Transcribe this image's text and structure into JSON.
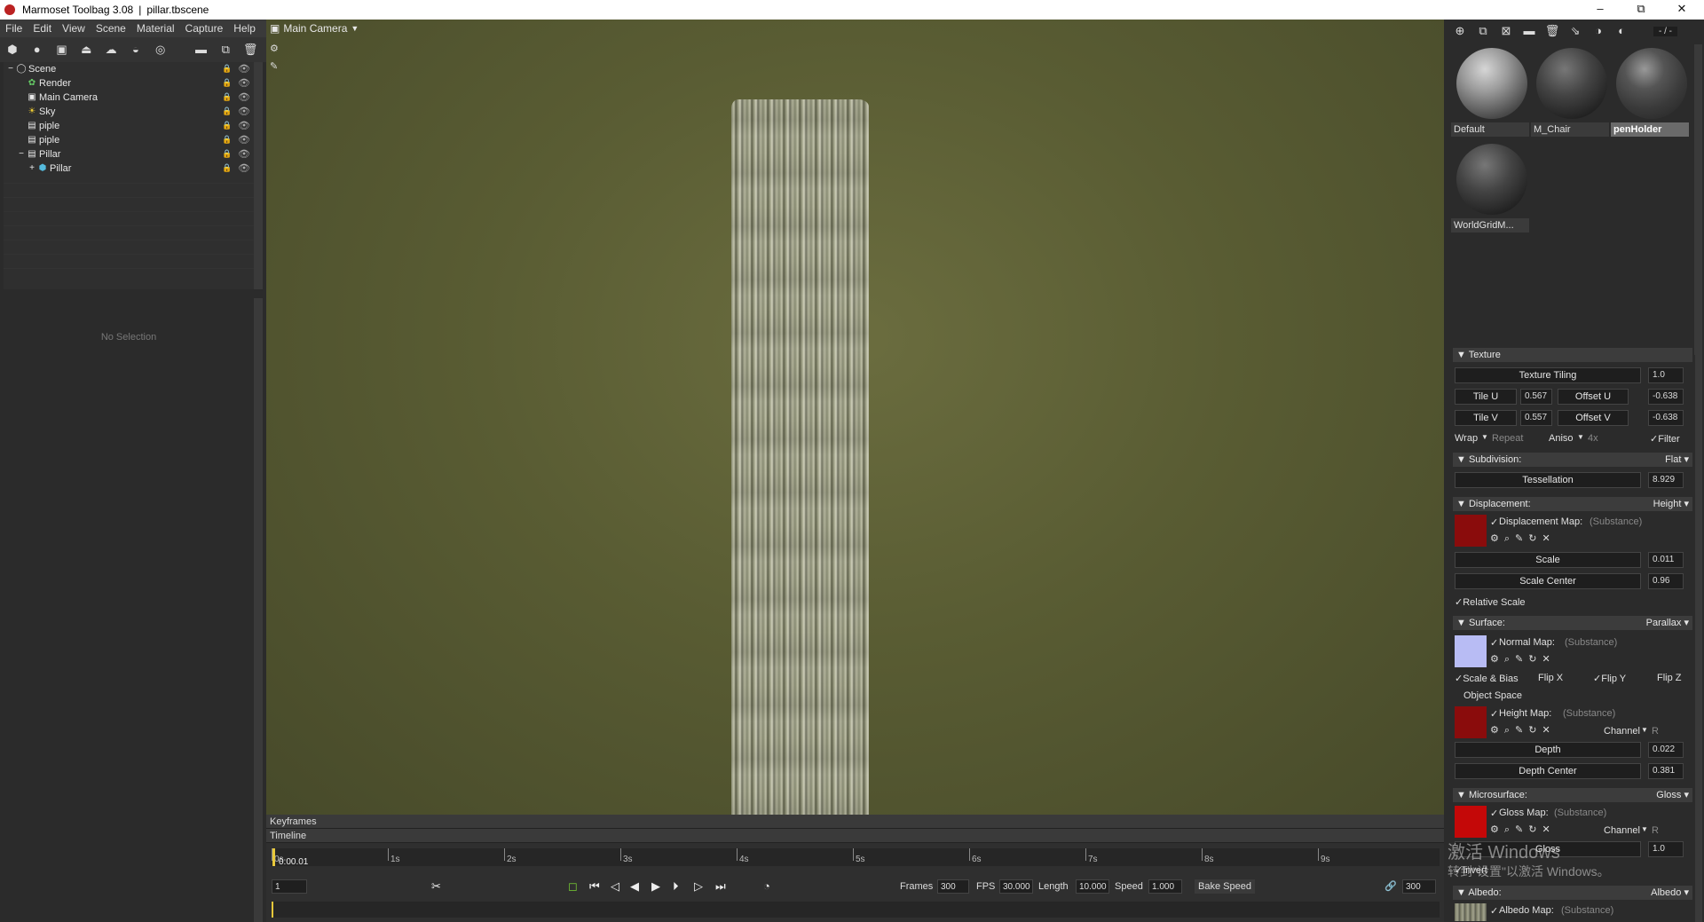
{
  "titlebar": {
    "app": "Marmoset Toolbag 3.08",
    "sep": "|",
    "file": "pillar.tbscene",
    "min": "–",
    "max": "⧉",
    "close": "✕"
  },
  "menu": [
    "File",
    "Edit",
    "View",
    "Scene",
    "Material",
    "Capture",
    "Help"
  ],
  "scene_tree": {
    "root": "Scene",
    "items": [
      {
        "label": "Render"
      },
      {
        "label": "Main Camera"
      },
      {
        "label": "Sky"
      },
      {
        "label": "piple"
      },
      {
        "label": "piple"
      },
      {
        "label": "Pillar"
      },
      {
        "label": "Pillar"
      }
    ]
  },
  "properties": {
    "empty_text": "No Selection"
  },
  "viewport": {
    "camera": "Main Camera"
  },
  "timeline": {
    "keyframes_label": "Keyframes",
    "timeline_label": "Timeline",
    "current_time": "0:00.01",
    "ticks": [
      "0s",
      "1s",
      "2s",
      "3s",
      "4s",
      "5s",
      "6s",
      "7s",
      "8s",
      "9s"
    ],
    "frame_field": "1",
    "frames_label": "Frames",
    "frames": "300",
    "fps_label": "FPS",
    "fps": "30.000",
    "length_label": "Length",
    "length": "10.000",
    "speed_label": "Speed",
    "speed": "1.000",
    "bake_label": "Bake Speed",
    "end_frame": "300"
  },
  "materials": {
    "counter": "- / -",
    "items": [
      {
        "name": "Default"
      },
      {
        "name": "M_Chair"
      },
      {
        "name": "penHolder"
      },
      {
        "name": "WorldGridM..."
      }
    ]
  },
  "texture": {
    "title": "Texture",
    "tiling_label": "Texture Tiling",
    "tiling": "1.0",
    "tile_u_label": "Tile U",
    "tile_u": "0.567",
    "offset_u_label": "Offset U",
    "offset_u": "-0.638",
    "tile_v_label": "Tile V",
    "tile_v": "0.557",
    "offset_v_label": "Offset V",
    "offset_v": "-0.638",
    "wrap_label": "Wrap",
    "wrap": "Repeat",
    "aniso_label": "Aniso",
    "aniso": "4x",
    "filter": "Filter"
  },
  "subdivision": {
    "title": "Subdivision:",
    "mode": "Flat",
    "tess_label": "Tessellation",
    "tess": "8.929"
  },
  "displacement": {
    "title": "Displacement:",
    "mode": "Height",
    "map_label": "Displacement Map:",
    "map_src": "(Substance)",
    "scale_label": "Scale",
    "scale": "0.011",
    "center_label": "Scale Center",
    "center": "0.96",
    "relative": "Relative Scale"
  },
  "surface": {
    "title": "Surface:",
    "mode": "Parallax",
    "normal_label": "Normal Map:",
    "normal_src": "(Substance)",
    "scale_bias": "Scale & Bias",
    "flip_x": "Flip X",
    "flip_y": "Flip Y",
    "flip_z": "Flip Z",
    "object_space": "Object Space",
    "height_label": "Height Map:",
    "height_src": "(Substance)",
    "channel_label": "Channel",
    "channel": "R",
    "depth_label": "Depth",
    "depth": "0.022",
    "depth_center_label": "Depth Center",
    "depth_center": "0.381"
  },
  "microsurface": {
    "title": "Microsurface:",
    "mode": "Gloss",
    "map_label": "Gloss Map:",
    "map_src": "(Substance)",
    "channel_label": "Channel",
    "channel": "R",
    "gloss_label": "Gloss",
    "gloss": "1.0",
    "invert": "Invert"
  },
  "albedo": {
    "title": "Albedo:",
    "mode": "Albedo",
    "map_label": "Albedo Map:",
    "map_src": "(Substance)"
  },
  "watermark": {
    "line1": "激活 Windows",
    "line2": "转到\"设置\"以激活 Windows。"
  }
}
